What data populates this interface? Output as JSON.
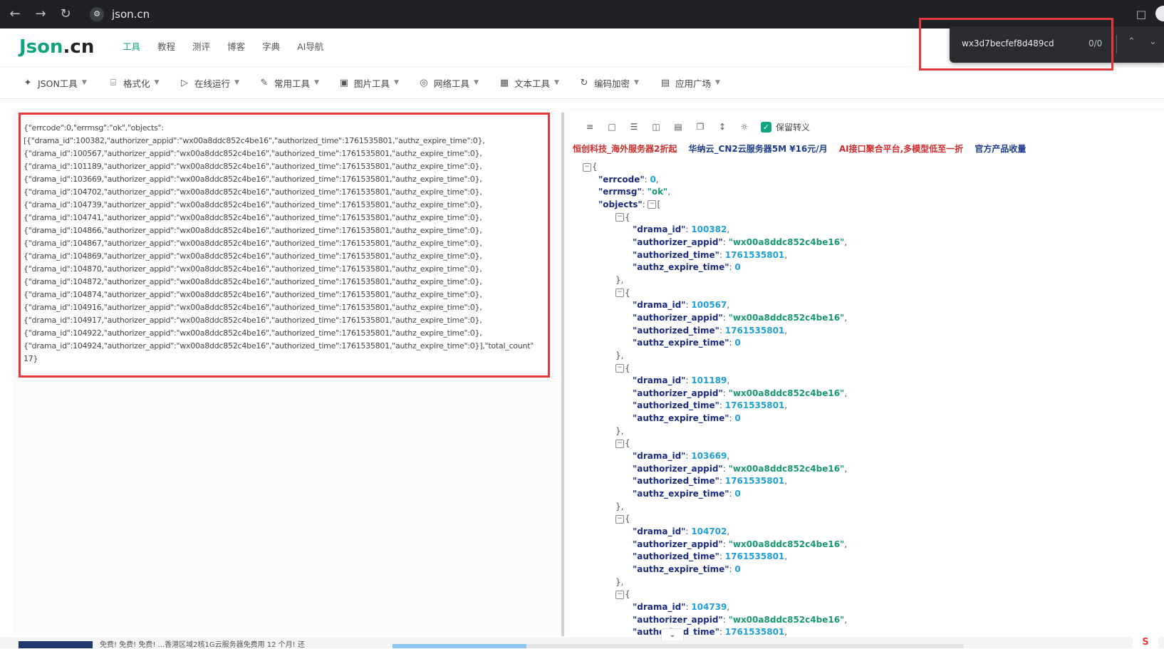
{
  "browser": {
    "back_icon": "arrow-left-icon",
    "forward_icon": "arrow-right-icon",
    "reload_icon": "reload-icon",
    "url": "json.cn"
  },
  "find_bar": {
    "query": "wx3d7becfef8d489cd",
    "count": "0/0"
  },
  "site": {
    "logo_json": "Json",
    "logo_cn": ".cn",
    "nav": [
      "工具",
      "教程",
      "测评",
      "博客",
      "字典",
      "AI导航"
    ]
  },
  "tools": [
    {
      "label": "JSON工具",
      "icon": "sparkle-icon"
    },
    {
      "label": "格式化",
      "icon": "paint-roller-icon"
    },
    {
      "label": "在线运行",
      "icon": "play-icon"
    },
    {
      "label": "常用工具",
      "icon": "brush-icon"
    },
    {
      "label": "图片工具",
      "icon": "image-icon"
    },
    {
      "label": "网络工具",
      "icon": "globe-icon"
    },
    {
      "label": "文本工具",
      "icon": "text-frame-icon"
    },
    {
      "label": "编码加密",
      "icon": "refresh-code-icon"
    },
    {
      "label": "应用广场",
      "icon": "app-store-icon"
    }
  ],
  "editor": {
    "raw_lines": [
      "{\"errcode\":0,\"errmsg\":\"ok\",\"objects\":",
      "[{\"drama_id\":100382,\"authorizer_appid\":\"wx00a8ddc852c4be16\",\"authorized_time\":1761535801,\"authz_expire_time\":0},",
      "{\"drama_id\":100567,\"authorizer_appid\":\"wx00a8ddc852c4be16\",\"authorized_time\":1761535801,\"authz_expire_time\":0},",
      "{\"drama_id\":101189,\"authorizer_appid\":\"wx00a8ddc852c4be16\",\"authorized_time\":1761535801,\"authz_expire_time\":0},",
      "{\"drama_id\":103669,\"authorizer_appid\":\"wx00a8ddc852c4be16\",\"authorized_time\":1761535801,\"authz_expire_time\":0},",
      "{\"drama_id\":104702,\"authorizer_appid\":\"wx00a8ddc852c4be16\",\"authorized_time\":1761535801,\"authz_expire_time\":0},",
      "{\"drama_id\":104739,\"authorizer_appid\":\"wx00a8ddc852c4be16\",\"authorized_time\":1761535801,\"authz_expire_time\":0},",
      "{\"drama_id\":104741,\"authorizer_appid\":\"wx00a8ddc852c4be16\",\"authorized_time\":1761535801,\"authz_expire_time\":0},",
      "{\"drama_id\":104866,\"authorizer_appid\":\"wx00a8ddc852c4be16\",\"authorized_time\":1761535801,\"authz_expire_time\":0},",
      "{\"drama_id\":104867,\"authorizer_appid\":\"wx00a8ddc852c4be16\",\"authorized_time\":1761535801,\"authz_expire_time\":0},",
      "{\"drama_id\":104869,\"authorizer_appid\":\"wx00a8ddc852c4be16\",\"authorized_time\":1761535801,\"authz_expire_time\":0},",
      "{\"drama_id\":104870,\"authorizer_appid\":\"wx00a8ddc852c4be16\",\"authorized_time\":1761535801,\"authz_expire_time\":0},",
      "{\"drama_id\":104872,\"authorizer_appid\":\"wx00a8ddc852c4be16\",\"authorized_time\":1761535801,\"authz_expire_time\":0},",
      "{\"drama_id\":104874,\"authorizer_appid\":\"wx00a8ddc852c4be16\",\"authorized_time\":1761535801,\"authz_expire_time\":0},",
      "{\"drama_id\":104916,\"authorizer_appid\":\"wx00a8ddc852c4be16\",\"authorized_time\":1761535801,\"authz_expire_time\":0},",
      "{\"drama_id\":104917,\"authorizer_appid\":\"wx00a8ddc852c4be16\",\"authorized_time\":1761535801,\"authz_expire_time\":0},",
      "{\"drama_id\":104922,\"authorizer_appid\":\"wx00a8ddc852c4be16\",\"authorized_time\":1761535801,\"authz_expire_time\":0},",
      "{\"drama_id\":104924,\"authorizer_appid\":\"wx00a8ddc852c4be16\",\"authorized_time\":1761535801,\"authz_expire_time\":0}],\"total_count\"",
      "17}"
    ]
  },
  "viewer": {
    "toolbar_icons": [
      "layers-icon",
      "file-code-icon",
      "list-ordered-icon",
      "trash-icon",
      "file-export-icon",
      "copy-icon",
      "compress-icon",
      "lightbulb-icon"
    ],
    "keep_escape_label": "保留转义",
    "ads": [
      {
        "text": "恒创科技_海外服务器2折起",
        "color": "#d12b2b"
      },
      {
        "text": "华纳云_CN2云服务器5M ¥16元/月",
        "color": "#1a3a8a"
      },
      {
        "text": "AI接口聚合平台,多模型低至一折",
        "color": "#d12b2b"
      },
      {
        "text": "官方产品收量",
        "color": "#1a3a8a"
      }
    ],
    "root": {
      "errcode": "0",
      "errmsg": "\"ok\""
    },
    "objects": [
      {
        "drama_id": "100382",
        "authorizer_appid": "\"wx00a8ddc852c4be16\"",
        "authorized_time": "1761535801",
        "authz_expire_time": "0"
      },
      {
        "drama_id": "100567",
        "authorizer_appid": "\"wx00a8ddc852c4be16\"",
        "authorized_time": "1761535801",
        "authz_expire_time": "0"
      },
      {
        "drama_id": "101189",
        "authorizer_appid": "\"wx00a8ddc852c4be16\"",
        "authorized_time": "1761535801",
        "authz_expire_time": "0"
      },
      {
        "drama_id": "103669",
        "authorizer_appid": "\"wx00a8ddc852c4be16\"",
        "authorized_time": "1761535801",
        "authz_expire_time": "0"
      },
      {
        "drama_id": "104702",
        "authorizer_appid": "\"wx00a8ddc852c4be16\"",
        "authorized_time": "1761535801",
        "authz_expire_time": "0"
      },
      {
        "drama_id": "104739",
        "authorizer_appid": "\"wx00a8ddc852c4be16\"",
        "authorized_time": "1761535801"
      }
    ]
  },
  "bottom": {
    "promo_text": "免费! 免费! 免费! ...香港区域2核1G云服务器免费用 12 个月! 还"
  },
  "colors": {
    "brand": "#11a37f",
    "highlight": "#e4393c",
    "json_key": "#1a2b80",
    "json_number": "#1ea0d8",
    "json_string": "#159a6b"
  }
}
